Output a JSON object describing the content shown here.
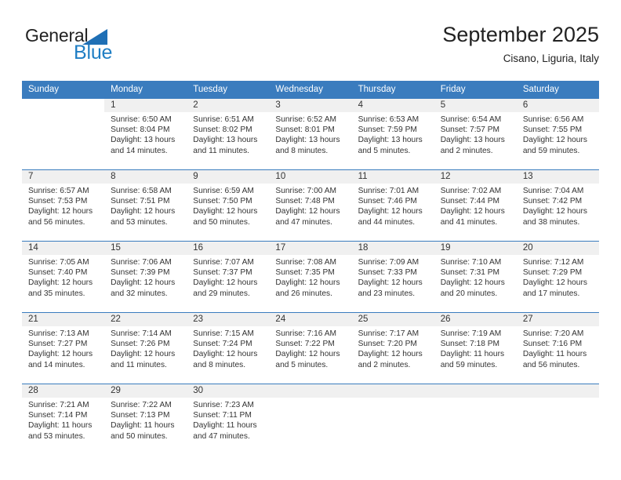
{
  "brand": {
    "word_one": "General",
    "word_two": "Blue",
    "triangle_color": "#1f6fb5",
    "blue_text_color": "#1f7ec4"
  },
  "header": {
    "title": "September 2025",
    "location": "Cisano, Liguria, Italy"
  },
  "theme": {
    "header_band": "#3a7cbe",
    "daynum_band": "#f0f0f0",
    "row_divider": "#3a7cbe"
  },
  "weekday_headers": [
    "Sunday",
    "Monday",
    "Tuesday",
    "Wednesday",
    "Thursday",
    "Friday",
    "Saturday"
  ],
  "labels": {
    "sunrise_prefix": "Sunrise:",
    "sunset_prefix": "Sunset:",
    "daylight_prefix": "Daylight:"
  },
  "weeks": [
    [
      {
        "day": "",
        "empty": true,
        "line1": "",
        "line2": "",
        "line3": "",
        "line4": ""
      },
      {
        "day": "1",
        "line1": "Sunrise: 6:50 AM",
        "line2": "Sunset: 8:04 PM",
        "line3": "Daylight: 13 hours",
        "line4": "and 14 minutes."
      },
      {
        "day": "2",
        "line1": "Sunrise: 6:51 AM",
        "line2": "Sunset: 8:02 PM",
        "line3": "Daylight: 13 hours",
        "line4": "and 11 minutes."
      },
      {
        "day": "3",
        "line1": "Sunrise: 6:52 AM",
        "line2": "Sunset: 8:01 PM",
        "line3": "Daylight: 13 hours",
        "line4": "and 8 minutes."
      },
      {
        "day": "4",
        "line1": "Sunrise: 6:53 AM",
        "line2": "Sunset: 7:59 PM",
        "line3": "Daylight: 13 hours",
        "line4": "and 5 minutes."
      },
      {
        "day": "5",
        "line1": "Sunrise: 6:54 AM",
        "line2": "Sunset: 7:57 PM",
        "line3": "Daylight: 13 hours",
        "line4": "and 2 minutes."
      },
      {
        "day": "6",
        "line1": "Sunrise: 6:56 AM",
        "line2": "Sunset: 7:55 PM",
        "line3": "Daylight: 12 hours",
        "line4": "and 59 minutes."
      }
    ],
    [
      {
        "day": "7",
        "line1": "Sunrise: 6:57 AM",
        "line2": "Sunset: 7:53 PM",
        "line3": "Daylight: 12 hours",
        "line4": "and 56 minutes."
      },
      {
        "day": "8",
        "line1": "Sunrise: 6:58 AM",
        "line2": "Sunset: 7:51 PM",
        "line3": "Daylight: 12 hours",
        "line4": "and 53 minutes."
      },
      {
        "day": "9",
        "line1": "Sunrise: 6:59 AM",
        "line2": "Sunset: 7:50 PM",
        "line3": "Daylight: 12 hours",
        "line4": "and 50 minutes."
      },
      {
        "day": "10",
        "line1": "Sunrise: 7:00 AM",
        "line2": "Sunset: 7:48 PM",
        "line3": "Daylight: 12 hours",
        "line4": "and 47 minutes."
      },
      {
        "day": "11",
        "line1": "Sunrise: 7:01 AM",
        "line2": "Sunset: 7:46 PM",
        "line3": "Daylight: 12 hours",
        "line4": "and 44 minutes."
      },
      {
        "day": "12",
        "line1": "Sunrise: 7:02 AM",
        "line2": "Sunset: 7:44 PM",
        "line3": "Daylight: 12 hours",
        "line4": "and 41 minutes."
      },
      {
        "day": "13",
        "line1": "Sunrise: 7:04 AM",
        "line2": "Sunset: 7:42 PM",
        "line3": "Daylight: 12 hours",
        "line4": "and 38 minutes."
      }
    ],
    [
      {
        "day": "14",
        "line1": "Sunrise: 7:05 AM",
        "line2": "Sunset: 7:40 PM",
        "line3": "Daylight: 12 hours",
        "line4": "and 35 minutes."
      },
      {
        "day": "15",
        "line1": "Sunrise: 7:06 AM",
        "line2": "Sunset: 7:39 PM",
        "line3": "Daylight: 12 hours",
        "line4": "and 32 minutes."
      },
      {
        "day": "16",
        "line1": "Sunrise: 7:07 AM",
        "line2": "Sunset: 7:37 PM",
        "line3": "Daylight: 12 hours",
        "line4": "and 29 minutes."
      },
      {
        "day": "17",
        "line1": "Sunrise: 7:08 AM",
        "line2": "Sunset: 7:35 PM",
        "line3": "Daylight: 12 hours",
        "line4": "and 26 minutes."
      },
      {
        "day": "18",
        "line1": "Sunrise: 7:09 AM",
        "line2": "Sunset: 7:33 PM",
        "line3": "Daylight: 12 hours",
        "line4": "and 23 minutes."
      },
      {
        "day": "19",
        "line1": "Sunrise: 7:10 AM",
        "line2": "Sunset: 7:31 PM",
        "line3": "Daylight: 12 hours",
        "line4": "and 20 minutes."
      },
      {
        "day": "20",
        "line1": "Sunrise: 7:12 AM",
        "line2": "Sunset: 7:29 PM",
        "line3": "Daylight: 12 hours",
        "line4": "and 17 minutes."
      }
    ],
    [
      {
        "day": "21",
        "line1": "Sunrise: 7:13 AM",
        "line2": "Sunset: 7:27 PM",
        "line3": "Daylight: 12 hours",
        "line4": "and 14 minutes."
      },
      {
        "day": "22",
        "line1": "Sunrise: 7:14 AM",
        "line2": "Sunset: 7:26 PM",
        "line3": "Daylight: 12 hours",
        "line4": "and 11 minutes."
      },
      {
        "day": "23",
        "line1": "Sunrise: 7:15 AM",
        "line2": "Sunset: 7:24 PM",
        "line3": "Daylight: 12 hours",
        "line4": "and 8 minutes."
      },
      {
        "day": "24",
        "line1": "Sunrise: 7:16 AM",
        "line2": "Sunset: 7:22 PM",
        "line3": "Daylight: 12 hours",
        "line4": "and 5 minutes."
      },
      {
        "day": "25",
        "line1": "Sunrise: 7:17 AM",
        "line2": "Sunset: 7:20 PM",
        "line3": "Daylight: 12 hours",
        "line4": "and 2 minutes."
      },
      {
        "day": "26",
        "line1": "Sunrise: 7:19 AM",
        "line2": "Sunset: 7:18 PM",
        "line3": "Daylight: 11 hours",
        "line4": "and 59 minutes."
      },
      {
        "day": "27",
        "line1": "Sunrise: 7:20 AM",
        "line2": "Sunset: 7:16 PM",
        "line3": "Daylight: 11 hours",
        "line4": "and 56 minutes."
      }
    ],
    [
      {
        "day": "28",
        "line1": "Sunrise: 7:21 AM",
        "line2": "Sunset: 7:14 PM",
        "line3": "Daylight: 11 hours",
        "line4": "and 53 minutes."
      },
      {
        "day": "29",
        "line1": "Sunrise: 7:22 AM",
        "line2": "Sunset: 7:13 PM",
        "line3": "Daylight: 11 hours",
        "line4": "and 50 minutes."
      },
      {
        "day": "30",
        "line1": "Sunrise: 7:23 AM",
        "line2": "Sunset: 7:11 PM",
        "line3": "Daylight: 11 hours",
        "line4": "and 47 minutes."
      },
      {
        "day": "",
        "empty_band": true,
        "line1": "",
        "line2": "",
        "line3": "",
        "line4": ""
      },
      {
        "day": "",
        "empty_band": true,
        "line1": "",
        "line2": "",
        "line3": "",
        "line4": ""
      },
      {
        "day": "",
        "empty_band": true,
        "line1": "",
        "line2": "",
        "line3": "",
        "line4": ""
      },
      {
        "day": "",
        "empty_band": true,
        "line1": "",
        "line2": "",
        "line3": "",
        "line4": ""
      }
    ]
  ]
}
